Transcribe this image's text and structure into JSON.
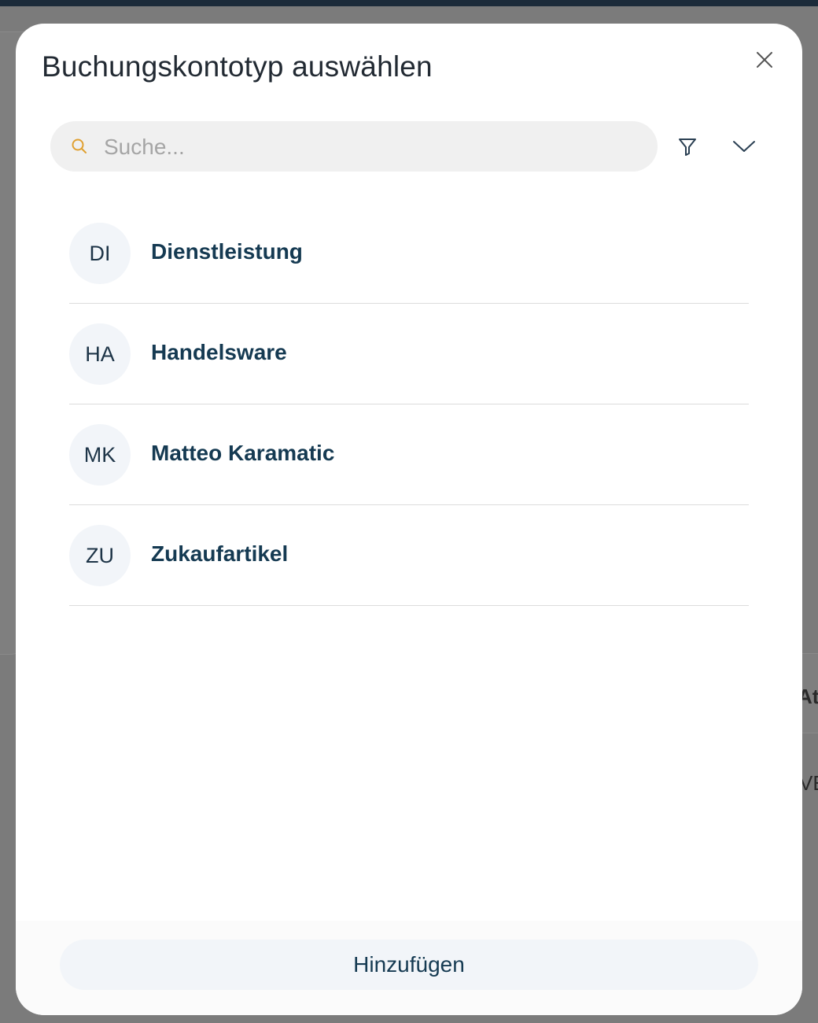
{
  "dialog": {
    "title": "Buchungskontotyp auswählen",
    "close_icon": "close-icon"
  },
  "search": {
    "placeholder": "Suche...",
    "value": "",
    "icon": "search-icon"
  },
  "toolbar": {
    "filter_icon": "filter-icon",
    "expand_icon": "chevron-down-icon"
  },
  "items": [
    {
      "initials": "DI",
      "label": "Dienstleistung"
    },
    {
      "initials": "HA",
      "label": "Handelsware"
    },
    {
      "initials": "MK",
      "label": "Matteo Karamatic"
    },
    {
      "initials": "ZU",
      "label": "Zukaufartikel"
    }
  ],
  "footer": {
    "add_label": "Hinzufügen"
  },
  "background": {
    "partial_text_1": "At",
    "partial_text_2": "VE"
  },
  "colors": {
    "accent_search_icon": "#e0a030",
    "item_text": "#153a52",
    "avatar_bg": "#f2f5f9"
  }
}
